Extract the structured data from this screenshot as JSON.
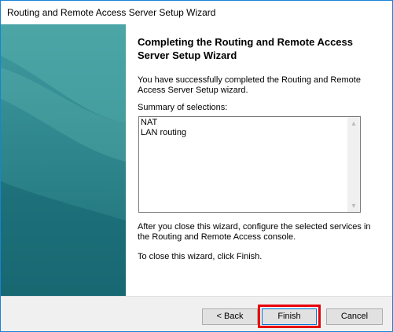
{
  "window": {
    "title": "Routing and Remote Access Server Setup Wizard"
  },
  "content": {
    "heading": "Completing the Routing and Remote Access Server Setup Wizard",
    "success_text": "You have successfully completed the Routing and Remote Access Server Setup wizard.",
    "summary_label": "Summary of selections:",
    "summary_items": [
      "NAT",
      "LAN routing"
    ],
    "after_text": "After you close this wizard, configure the selected services in the Routing and  Remote Access console.",
    "close_text": "To close this wizard, click Finish."
  },
  "footer": {
    "back_label": "< Back",
    "finish_label": "Finish",
    "cancel_label": "Cancel"
  },
  "icons": {
    "scroll_up": "chevron-up-icon",
    "scroll_down": "chevron-down-icon"
  },
  "colors": {
    "window_border": "#1883d7",
    "side_panel": "#2f878d",
    "highlight": "#e8000a",
    "default_button_border": "#0078d7"
  }
}
